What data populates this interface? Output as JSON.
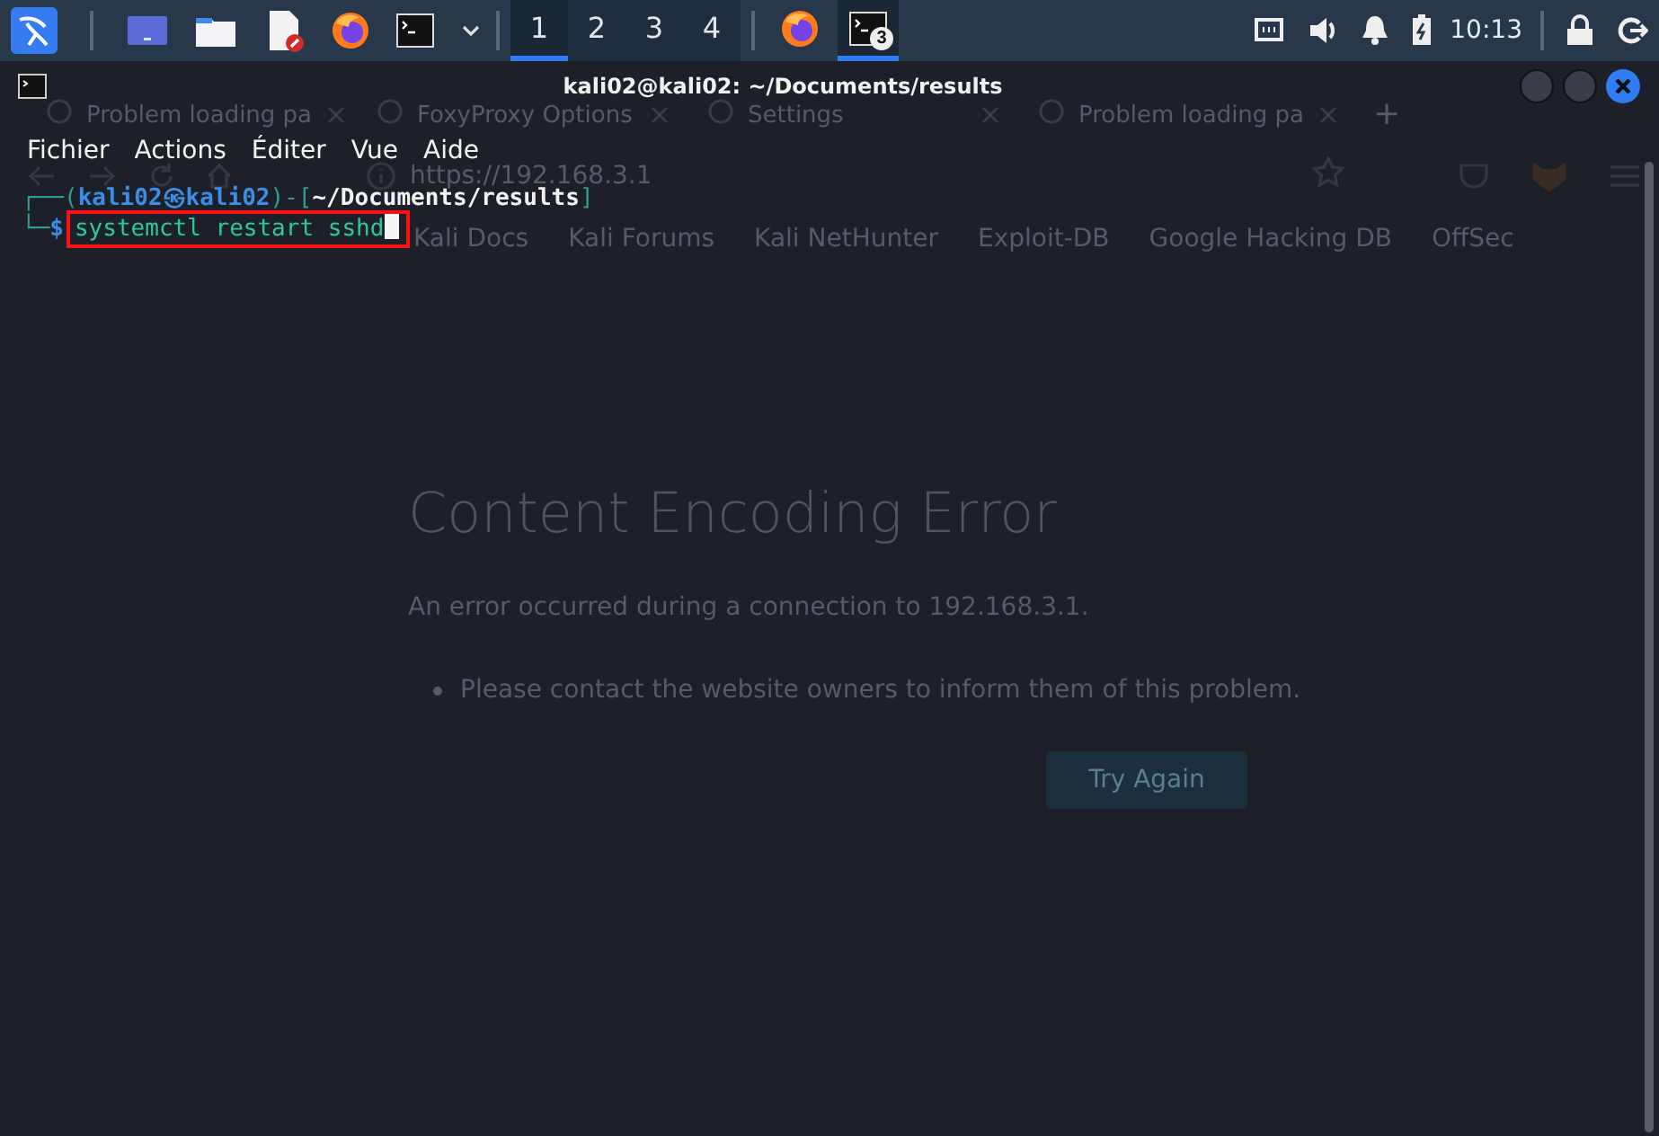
{
  "taskbar": {
    "launchers": [
      {
        "kind": "kali-menu"
      },
      {
        "kind": "desktop"
      },
      {
        "kind": "files"
      },
      {
        "kind": "text-editor"
      },
      {
        "kind": "firefox"
      },
      {
        "kind": "terminal"
      },
      {
        "kind": "caret"
      }
    ],
    "workspaces": [
      {
        "label": "1",
        "selected": true
      },
      {
        "label": "2",
        "selected": false
      },
      {
        "label": "3",
        "selected": false
      },
      {
        "label": "4",
        "selected": false
      }
    ],
    "windows": [
      {
        "kind": "firefox",
        "selected": false
      },
      {
        "kind": "terminal",
        "selected": true,
        "badge": "3"
      }
    ],
    "tray": [
      {
        "kind": "network"
      },
      {
        "kind": "volume"
      },
      {
        "kind": "bell"
      },
      {
        "kind": "battery"
      }
    ],
    "clock": "10:13",
    "actions": [
      {
        "kind": "lock"
      },
      {
        "kind": "logout"
      }
    ]
  },
  "browser_behind": {
    "tabs": [
      {
        "label": "Problem loading pa"
      },
      {
        "label": "FoxyProxy Options"
      },
      {
        "label": "Settings"
      },
      {
        "label": "Problem loading pa"
      }
    ],
    "new_tab": "+",
    "url": "https://192.168.3.1",
    "bookmarks": [
      "Kali Docs",
      "Kali Forums",
      "Kali NetHunter",
      "Exploit-DB",
      "Google Hacking DB",
      "OffSec"
    ],
    "page": {
      "heading": "Content Encoding Error",
      "message": "An error occurred during a connection to 192.168.3.1.",
      "bullets": [
        "Please contact the website owners to inform them of this problem."
      ],
      "button": "Try Again"
    }
  },
  "terminal": {
    "title": "kali02@kali02: ~/Documents/results",
    "menu": [
      "Fichier",
      "Actions",
      "Éditer",
      "Vue",
      "Aide"
    ],
    "lines": [
      [
        {
          "kind": "frame",
          "text": "┌──("
        },
        {
          "kind": "user",
          "text": "kali02"
        },
        {
          "kind": "user",
          "text": "㉿"
        },
        {
          "kind": "user",
          "text": "kali02"
        },
        {
          "kind": "frame",
          "text": ")-["
        },
        {
          "kind": "path",
          "text": "~/Documents/results"
        },
        {
          "kind": "frame",
          "text": "]"
        }
      ],
      [
        {
          "kind": "frame",
          "text": "└─"
        },
        {
          "kind": "sign",
          "text": "$"
        },
        {
          "kind": "command",
          "text": "systemctl restart sshd",
          "highlighted": true,
          "cursor": true
        }
      ]
    ]
  }
}
